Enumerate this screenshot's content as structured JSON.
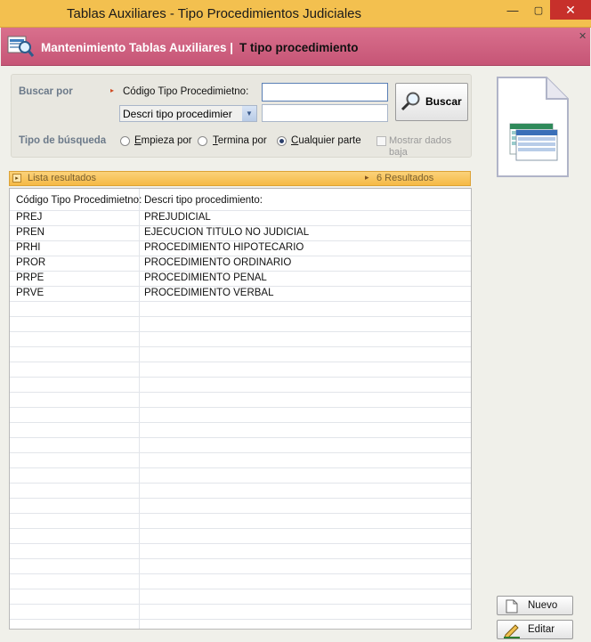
{
  "window": {
    "title": "Tablas Auxiliares - Tipo Procedimientos Judiciales",
    "min_glyph": "—",
    "max_glyph": "▢",
    "close_glyph": "✕"
  },
  "header": {
    "title_a": "Mantenimiento Tablas Auxiliares  |",
    "title_b": "T tipo procedimiento",
    "close_glyph": "✕"
  },
  "search": {
    "buscar_por_label": "Buscar por",
    "field1_label": "Código Tipo Procedimietno:",
    "field1_value": "",
    "dropdown_value": "Descri tipo procedimier",
    "field2_value": "",
    "tipo_busqueda_label": "Tipo de búsqueda",
    "options": [
      {
        "label": "Empieza por",
        "underline": "E",
        "rest": "mpieza por",
        "selected": false
      },
      {
        "label": "Termina por",
        "underline": "T",
        "rest": "ermina por",
        "selected": false
      },
      {
        "label": "Cualquier parte",
        "underline": "C",
        "rest": "ualquier parte",
        "selected": true
      }
    ],
    "mostrar_baja_line1": "Mostrar dados",
    "mostrar_baja_line2": "baja",
    "buscar_button": "Buscar"
  },
  "results_bar": {
    "label": "Lista resultados",
    "count": "6 Resultados"
  },
  "table": {
    "headers": [
      "Código Tipo Procedimietno:",
      "Descri tipo procedimiento:"
    ],
    "rows": [
      [
        "PREJ",
        "PREJUDICIAL"
      ],
      [
        "PREN",
        "EJECUCION TITULO NO JUDICIAL"
      ],
      [
        "PRHI",
        "PROCEDIMIENTO HIPOTECARIO"
      ],
      [
        "PROR",
        "PROCEDIMIENTO ORDINARIO"
      ],
      [
        "PRPE",
        "PROCEDIMIENTO PENAL"
      ],
      [
        "PRVE",
        "PROCEDIMIENTO VERBAL"
      ]
    ]
  },
  "side": {
    "nuevo_button": "Nuevo",
    "editar_button": "Editar"
  },
  "icons": {
    "header_icon": "search-document-icon",
    "buscar_icon": "magnifier-icon",
    "doc_icon": "table-document-icon",
    "nuevo_icon": "new-page-icon",
    "editar_icon": "pencil-icon"
  },
  "colors": {
    "titlebar": "#f3c04f",
    "header": "#cd5f7e",
    "results_bar": "#f7c255",
    "close": "#c7302b"
  }
}
